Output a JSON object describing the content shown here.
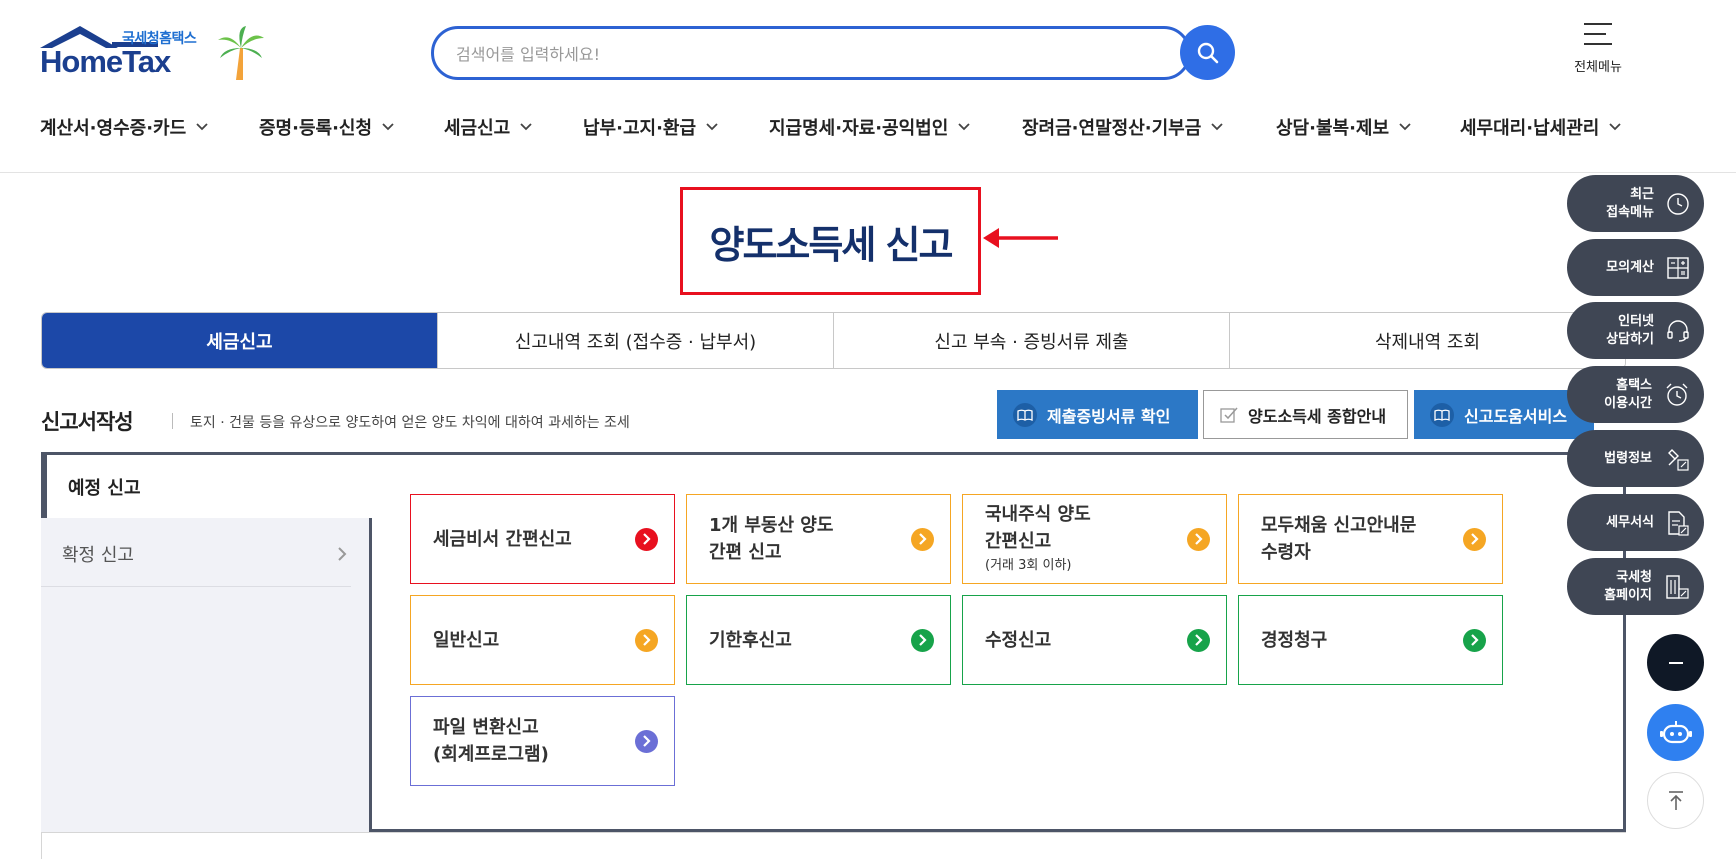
{
  "header": {
    "logo_top": "국세청홈택스",
    "logo_main": "HomeTax",
    "search_placeholder": "검색어를 입력하세요!",
    "all_menu_label": "전체메뉴"
  },
  "gnb": [
    {
      "label": "계산서·영수증·카드"
    },
    {
      "label": "증명·등록·신청"
    },
    {
      "label": "세금신고"
    },
    {
      "label": "납부·고지·환급"
    },
    {
      "label": "지급명세·자료·공익법인"
    },
    {
      "label": "장려금·연말정산·기부금"
    },
    {
      "label": "상담·불복·제보"
    },
    {
      "label": "세무대리·납세관리"
    }
  ],
  "page": {
    "title": "양도소득세 신고"
  },
  "tabs": [
    {
      "label": "세금신고",
      "active": true
    },
    {
      "label": "신고내역 조회 (접수증 · 납부서)",
      "active": false
    },
    {
      "label": "신고 부속 · 증빙서류 제출",
      "active": false
    },
    {
      "label": "삭제내역 조회",
      "active": false
    }
  ],
  "section": {
    "title": "신고서작성",
    "description": "토지 · 건물 등을 유상으로 양도하여 얻은 양도 차익에 대하여 과세하는 조세"
  },
  "action_buttons": {
    "docs_check": "제출증빙서류 확인",
    "guide": "양도소득세 종합안내",
    "help_service": "신고도움서비스"
  },
  "side_menu": {
    "active": "예정 신고",
    "item": "확정 신고"
  },
  "cards": [
    {
      "line1": "세금비서 간편신고",
      "line2": "",
      "sub": "",
      "color": "#e8101f"
    },
    {
      "line1": "1개 부동산 양도",
      "line2": "간편 신고",
      "sub": "",
      "color": "#f5a623"
    },
    {
      "line1": "국내주식 양도",
      "line2": "간편신고",
      "sub": "(거래 3회 이하)",
      "color": "#f5a623"
    },
    {
      "line1": "모두채움 신고안내문",
      "line2": "수령자",
      "sub": "",
      "color": "#f5a623"
    },
    {
      "line1": "일반신고",
      "line2": "",
      "sub": "",
      "color": "#f5a623"
    },
    {
      "line1": "기한후신고",
      "line2": "",
      "sub": "",
      "color": "#17a34a"
    },
    {
      "line1": "수정신고",
      "line2": "",
      "sub": "",
      "color": "#17a34a"
    },
    {
      "line1": "경정청구",
      "line2": "",
      "sub": "",
      "color": "#17a34a"
    },
    {
      "line1": "파일 변환신고",
      "line2": "(회계프로그램)",
      "sub": "",
      "color": "#6b6fd6"
    }
  ],
  "quick_menu": [
    {
      "line1": "최근",
      "line2": "접속메뉴",
      "icon": "clock-icon"
    },
    {
      "line1": "모의계산",
      "line2": "",
      "icon": "calculator-icon"
    },
    {
      "line1": "인터넷",
      "line2": "상담하기",
      "icon": "headset-icon"
    },
    {
      "line1": "홈택스",
      "line2": "이용시간",
      "icon": "alarm-icon"
    },
    {
      "line1": "법령정보",
      "line2": "",
      "icon": "gavel-icon"
    },
    {
      "line1": "세무서식",
      "line2": "",
      "icon": "document-icon"
    },
    {
      "line1": "국세청",
      "line2": "홈페이지",
      "icon": "building-icon"
    }
  ],
  "colors": {
    "primary": "#1c48a8",
    "accent_blue": "#2c78c6",
    "highlight_red": "#e8101f",
    "quick_bg": "#3f4654"
  }
}
